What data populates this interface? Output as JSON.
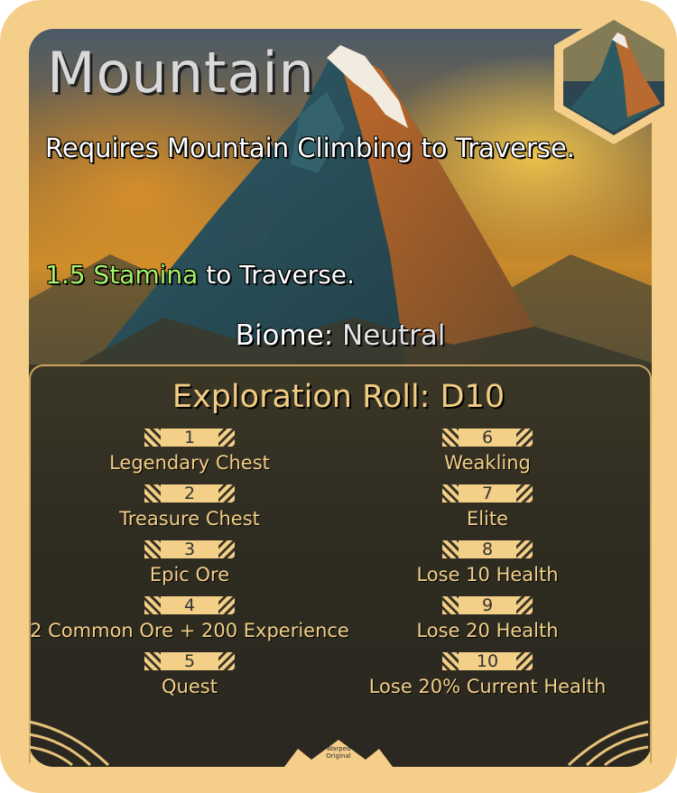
{
  "card": {
    "title": "Mountain",
    "requirement": "Requires Mountain Climbing to Traverse.",
    "stamina": {
      "highlight": "1.5 Stamina",
      "rest": " to Traverse."
    },
    "biome": {
      "label": "Biome: ",
      "value": "Neutral"
    },
    "exploration": {
      "title": "Exploration Roll: D10",
      "entries": [
        {
          "number": "1",
          "label": "Legendary Chest"
        },
        {
          "number": "2",
          "label": "Treasure Chest"
        },
        {
          "number": "3",
          "label": "Epic Ore"
        },
        {
          "number": "4",
          "label": "2 Common Ore + 200 Experience"
        },
        {
          "number": "5",
          "label": "Quest"
        },
        {
          "number": "6",
          "label": "Weakling"
        },
        {
          "number": "7",
          "label": "Elite"
        },
        {
          "number": "8",
          "label": "Lose 10 Health"
        },
        {
          "number": "9",
          "label": "Lose 20 Health"
        },
        {
          "number": "10",
          "label": "Lose 20% Current Health"
        }
      ]
    },
    "logo": {
      "line1": "Warped",
      "line2": "Original"
    }
  },
  "colors": {
    "frame": "#f5cf8a",
    "stamina_highlight": "#a6f06a",
    "roll_title": "#f1cc82",
    "entry_text": "#f3cf88"
  },
  "icons": {
    "thumbnail": "mountain-thumbnail-icon",
    "logo": "warped-original-logo"
  }
}
